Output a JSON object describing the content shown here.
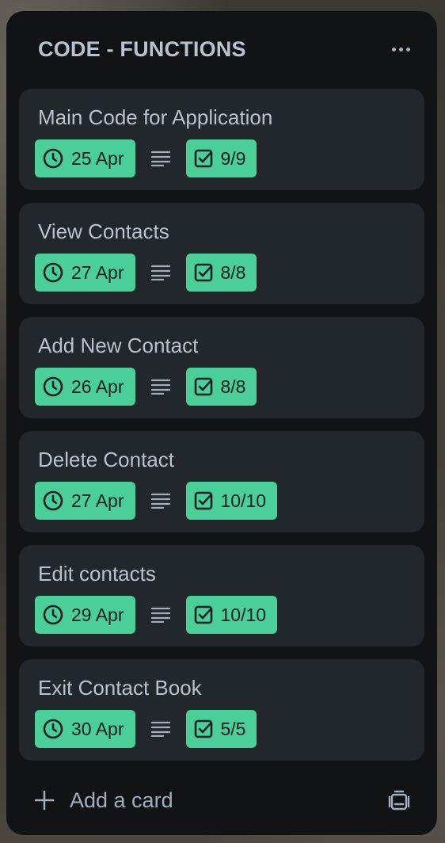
{
  "list": {
    "title": "CODE - FUNCTIONS",
    "more_icon": "ellipsis-icon",
    "cards": [
      {
        "title": "Main Code for Application",
        "due": "25 Apr",
        "checklist": "9/9"
      },
      {
        "title": "View Contacts",
        "due": "27 Apr",
        "checklist": "8/8"
      },
      {
        "title": "Add New Contact",
        "due": "26 Apr",
        "checklist": "8/8"
      },
      {
        "title": "Delete Contact",
        "due": "27 Apr",
        "checklist": "10/10"
      },
      {
        "title": "Edit contacts",
        "due": "29 Apr",
        "checklist": "10/10"
      },
      {
        "title": "Exit Contact Book",
        "due": "30 Apr",
        "checklist": "5/5"
      }
    ],
    "add_card_label": "Add a card",
    "template_icon": "card-template-icon"
  },
  "colors": {
    "list_bg": "#101214",
    "card_bg": "#22272b",
    "badge_bg": "#4bce97",
    "text": "#b6c2cf"
  }
}
